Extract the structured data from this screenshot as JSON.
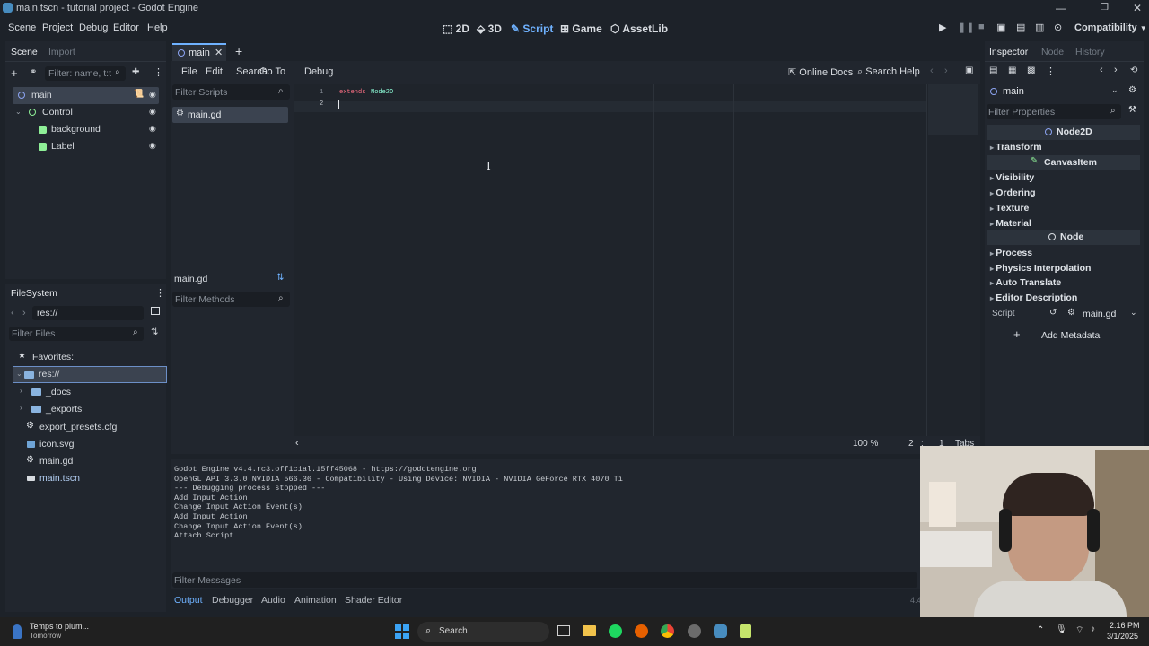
{
  "window": {
    "title": "main.tscn - tutorial project - Godot Engine",
    "min": "—",
    "max": "❐",
    "close": "✕"
  },
  "menu": {
    "items": [
      "Scene",
      "Project",
      "Debug",
      "Editor",
      "Help"
    ]
  },
  "workspaces": [
    {
      "label": "2D",
      "icon": "2d-icon"
    },
    {
      "label": "3D",
      "icon": "3d-icon"
    },
    {
      "label": "Script",
      "icon": "script-icon",
      "active": true
    },
    {
      "label": "Game",
      "icon": "game-icon"
    },
    {
      "label": "AssetLib",
      "icon": "assetlib-icon"
    }
  ],
  "renderer": "Compatibility",
  "scene_dock": {
    "tabs": [
      "Scene",
      "Import"
    ],
    "filter_placeholder": "Filter: name, t:t",
    "tree": [
      {
        "label": "main",
        "icon": "node2d-icon",
        "depth": 0,
        "selected": true,
        "color": "#8da5f3"
      },
      {
        "label": "Control",
        "icon": "control-icon",
        "depth": 1,
        "color": "#8eef97"
      },
      {
        "label": "background",
        "icon": "colorrect-icon",
        "depth": 2,
        "color": "#8eef97"
      },
      {
        "label": "Label",
        "icon": "label-icon",
        "depth": 2,
        "color": "#8eef97"
      }
    ]
  },
  "filesystem": {
    "title": "FileSystem",
    "path": "res://",
    "filter_placeholder": "Filter Files",
    "favorites": "Favorites:",
    "items": [
      {
        "label": "res://",
        "icon": "folder-icon",
        "depth": 0,
        "selected": true
      },
      {
        "label": "_docs",
        "icon": "folder-icon",
        "depth": 1
      },
      {
        "label": "_exports",
        "icon": "folder-icon",
        "depth": 1
      },
      {
        "label": "export_presets.cfg",
        "icon": "gear-icon",
        "depth": 1
      },
      {
        "label": "icon.svg",
        "icon": "image-icon",
        "depth": 1
      },
      {
        "label": "main.gd",
        "icon": "gear-icon",
        "depth": 1
      },
      {
        "label": "main.tscn",
        "icon": "scene-icon",
        "depth": 1
      }
    ]
  },
  "script_editor": {
    "open_tab": "main",
    "menus": [
      "File",
      "Edit",
      "Search",
      "Go To",
      "Debug"
    ],
    "online_docs": "Online Docs",
    "search_help": "Search Help",
    "filter_scripts": "Filter Scripts",
    "scripts": [
      "main.gd"
    ],
    "current_script": "main.gd",
    "filter_methods": "Filter Methods",
    "lines": [
      {
        "num": "1",
        "kw": "extends",
        "rest": "Node2D"
      },
      {
        "num": "2",
        "kw": "",
        "rest": ""
      }
    ],
    "zoom": "100 %",
    "cursor_line": "2",
    "cursor_col": "1",
    "indent": "Tabs"
  },
  "output": {
    "lines": [
      "Godot Engine v4.4.rc3.official.15ff45068 - https://godotengine.org",
      "OpenGL API 3.3.0 NVIDIA 566.36 - Compatibility - Using Device: NVIDIA - NVIDIA GeForce RTX 4070 Ti",
      "",
      "--- Debugging process stopped ---",
      "Add Input Action",
      "Change Input Action Event(s)",
      "Add Input Action",
      "Change Input Action Event(s)",
      "Attach Script"
    ],
    "filter_placeholder": "Filter Messages",
    "bottom_tabs": [
      "Output",
      "Debugger",
      "Audio",
      "Animation",
      "Shader Editor"
    ],
    "version": "4.4"
  },
  "inspector": {
    "tabs": [
      "Inspector",
      "Node",
      "History"
    ],
    "object": "main",
    "filter_placeholder": "Filter Properties",
    "class_node2d": "Node2D",
    "sections_a": [
      "Transform"
    ],
    "class_canvasitem": "CanvasItem",
    "sections_b": [
      "Visibility",
      "Ordering",
      "Texture",
      "Material"
    ],
    "class_node": "Node",
    "sections_c": [
      "Process",
      "Physics Interpolation",
      "Auto Translate",
      "Editor Description"
    ],
    "script_label": "Script",
    "script_value": "main.gd",
    "add_metadata": "Add Metadata"
  },
  "taskbar": {
    "weather_title": "Temps to plum...",
    "weather_sub": "Tomorrow",
    "search": "Search",
    "time": "2:16 PM",
    "date": "3/1/2025"
  }
}
